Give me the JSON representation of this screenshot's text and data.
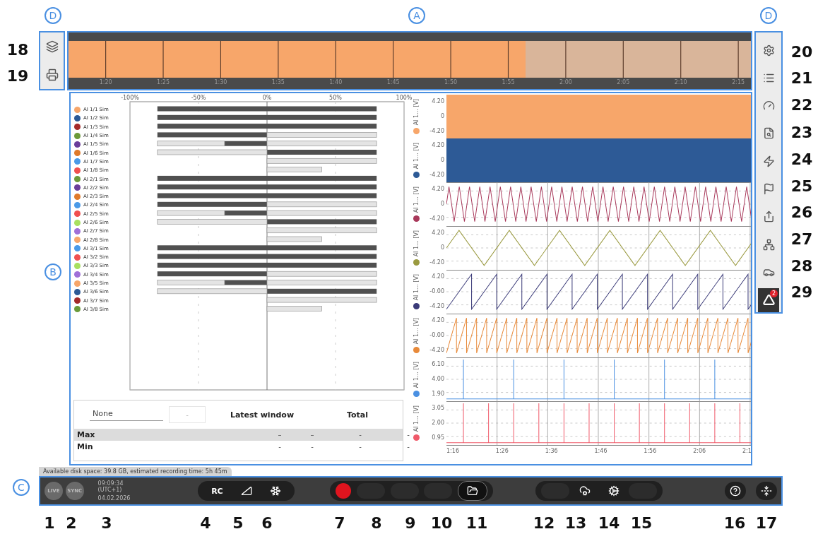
{
  "callouts": {
    "letters": [
      "D",
      "A",
      "D",
      "B",
      "C"
    ],
    "numbers": [
      "1",
      "2",
      "3",
      "4",
      "5",
      "6",
      "7",
      "8",
      "9",
      "10",
      "11",
      "12",
      "13",
      "14",
      "15",
      "16",
      "17",
      "18",
      "19",
      "20",
      "21",
      "22",
      "23",
      "24",
      "25",
      "26",
      "27",
      "28",
      "29"
    ]
  },
  "left_toolbar": [
    {
      "kind": "windows"
    },
    {
      "kind": "print"
    }
  ],
  "overview": {
    "level": 0.67,
    "ticks": [
      "1:20",
      "1:25",
      "1:30",
      "1:35",
      "1:40",
      "1:45",
      "1:50",
      "1:55",
      "2:00",
      "2:05",
      "2:10",
      "2:15"
    ]
  },
  "channels": [
    {
      "name": "AI 1/1 Sim",
      "color": "#f7a66a"
    },
    {
      "name": "AI 1/2 Sim",
      "color": "#2d5a96"
    },
    {
      "name": "AI 1/3 Sim",
      "color": "#a52a2a"
    },
    {
      "name": "AI 1/4 Sim",
      "color": "#6b9a3a"
    },
    {
      "name": "AI 1/5 Sim",
      "color": "#6a3d9a"
    },
    {
      "name": "AI 1/6 Sim",
      "color": "#e07a2a"
    },
    {
      "name": "AI 1/7 Sim",
      "color": "#4a9ae8"
    },
    {
      "name": "AI 1/8 Sim",
      "color": "#f05050"
    },
    {
      "name": "AI 2/1 Sim",
      "color": "#6b9a3a"
    },
    {
      "name": "AI 2/2 Sim",
      "color": "#6a3d9a"
    },
    {
      "name": "AI 2/3 Sim",
      "color": "#e07a2a"
    },
    {
      "name": "AI 2/4 Sim",
      "color": "#4a9ae8"
    },
    {
      "name": "AI 2/5 Sim",
      "color": "#f05050"
    },
    {
      "name": "AI 2/6 Sim",
      "color": "#a8e060"
    },
    {
      "name": "AI 2/7 Sim",
      "color": "#a070d8"
    },
    {
      "name": "AI 2/8 Sim",
      "color": "#f7a66a"
    },
    {
      "name": "AI 3/1 Sim",
      "color": "#4a9ae8"
    },
    {
      "name": "AI 3/2 Sim",
      "color": "#f05050"
    },
    {
      "name": "AI 3/3 Sim",
      "color": "#a8e060"
    },
    {
      "name": "AI 3/4 Sim",
      "color": "#a070d8"
    },
    {
      "name": "AI 3/5 Sim",
      "color": "#f7a66a"
    },
    {
      "name": "AI 3/6 Sim",
      "color": "#2d5a96"
    },
    {
      "name": "AI 3/7 Sim",
      "color": "#a52a2a"
    },
    {
      "name": "AI 3/8 Sim",
      "color": "#6b9a3a"
    }
  ],
  "chart_data": {
    "type": "bar",
    "orientation": "horizontal",
    "xlim": [
      -100,
      100
    ],
    "xticks": [
      {
        "value": -100,
        "label": "-100%"
      },
      {
        "value": -50,
        "label": "-50%"
      },
      {
        "value": 0,
        "label": "0%"
      },
      {
        "value": 50,
        "label": "50%"
      },
      {
        "value": 100,
        "label": "100%"
      }
    ],
    "stacked": true,
    "series": [
      {
        "color": "#505050",
        "values": [
          -80,
          -80,
          -80,
          -80,
          -31,
          null,
          null,
          null,
          -80,
          -80,
          -80,
          -80,
          -31,
          null,
          null,
          null,
          -80,
          -80,
          -80,
          -80,
          -31,
          null,
          null,
          null
        ]
      },
      {
        "color": "#505050",
        "values": [
          80,
          80,
          80,
          null,
          null,
          80,
          null,
          null,
          80,
          80,
          80,
          null,
          null,
          80,
          null,
          null,
          80,
          80,
          80,
          null,
          null,
          80,
          null,
          null
        ]
      },
      {
        "color": "#e4e4e4",
        "values": [
          null,
          null,
          null,
          null,
          -49,
          -80,
          null,
          null,
          null,
          null,
          null,
          null,
          -49,
          -80,
          null,
          null,
          null,
          null,
          null,
          null,
          -49,
          -80,
          null,
          null
        ]
      },
      {
        "color": "#e4e4e4",
        "values": [
          null,
          null,
          null,
          80,
          80,
          null,
          80,
          40,
          null,
          null,
          null,
          80,
          80,
          null,
          80,
          40,
          null,
          null,
          null,
          80,
          80,
          null,
          80,
          40
        ]
      }
    ]
  },
  "stats": {
    "selector": "None",
    "button": "-",
    "headers": [
      "Latest window",
      "Total"
    ],
    "rows": [
      {
        "label": "Max",
        "values": [
          "–",
          "–",
          "-",
          "-"
        ]
      },
      {
        "label": "Min",
        "values": [
          "-",
          "-",
          "-",
          "-"
        ]
      }
    ]
  },
  "strips": [
    {
      "label": "AI 1... [V]",
      "color": "#f7a66a",
      "kind": "band",
      "ticks": [
        "4.20",
        "0",
        "-4.20"
      ]
    },
    {
      "label": "AI 1... [V]",
      "color": "#2d5a96",
      "kind": "band",
      "ticks": [
        "4.20",
        "0",
        "-4.20"
      ]
    },
    {
      "label": "AI 1... [V]",
      "color": "#a8385a",
      "kind": "fast-triangle",
      "ticks": [
        "4.20",
        "0",
        "-4.20"
      ]
    },
    {
      "label": "AI 1... [V]",
      "color": "#9a9a40",
      "kind": "slow-triangle",
      "ticks": [
        "4.20",
        "0",
        "-4.20"
      ]
    },
    {
      "label": "AI 1... [V]",
      "color": "#3a3a78",
      "kind": "sawtooth",
      "ticks": [
        "4.20",
        "-0.00",
        "-4.20"
      ]
    },
    {
      "label": "AI 1... [V]",
      "color": "#e88a3a",
      "kind": "fast-sawtooth",
      "ticks": [
        "4.20",
        "-0.00",
        "-4.20"
      ]
    },
    {
      "label": "AI 1... [V]",
      "color": "#4a90e2",
      "kind": "pulse",
      "ticks": [
        "6.10",
        "4.00",
        "1.90"
      ]
    },
    {
      "label": "AI 1... [V]",
      "color": "#f05a6a",
      "kind": "fast-pulse",
      "ticks": [
        "3.05",
        "2.00",
        "0.95"
      ]
    }
  ],
  "strip_times": [
    "1:16",
    "1:26",
    "1:36",
    "1:46",
    "1:56",
    "2:06",
    "2:1"
  ],
  "status": "Available disk space: 39.8 GB, estimated recording time: 5h 45m",
  "bottom_bar": {
    "live": "LIVE",
    "sync": "SYNC",
    "time": "09:09:34 (UTC+1)",
    "date": "04.02.2026",
    "rc": "RC"
  },
  "right_toolbar": [
    {
      "kind": "settings",
      "selected": false
    },
    {
      "kind": "list",
      "selected": false
    },
    {
      "kind": "gauge",
      "selected": false
    },
    {
      "kind": "report",
      "selected": false
    },
    {
      "kind": "bolt",
      "selected": false
    },
    {
      "kind": "flag",
      "selected": false
    },
    {
      "kind": "share",
      "selected": false
    },
    {
      "kind": "hierarchy",
      "selected": false
    },
    {
      "kind": "car",
      "selected": false
    },
    {
      "kind": "triangle",
      "selected": true,
      "badge": "2"
    }
  ]
}
